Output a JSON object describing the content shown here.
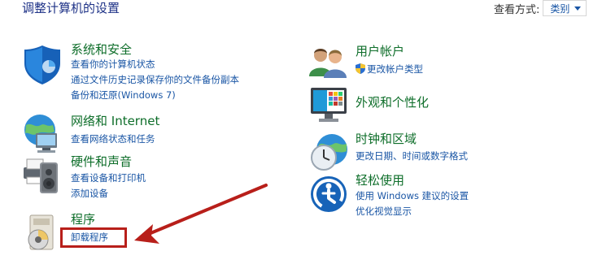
{
  "header": {
    "title": "调整计算机的设置",
    "view_by_label": "查看方式:",
    "view_by_value": "类别"
  },
  "categories": [
    {
      "title": "系统和安全",
      "icon": "shield-icon",
      "links": [
        "查看你的计算机状态",
        "通过文件历史记录保存你的文件备份副本",
        "备份和还原(Windows 7)"
      ]
    },
    {
      "title": "网络和 Internet",
      "icon": "network-globe-icon",
      "links": [
        "查看网络状态和任务"
      ]
    },
    {
      "title": "硬件和声音",
      "icon": "printer-speaker-icon",
      "links": [
        "查看设备和打印机",
        "添加设备"
      ]
    },
    {
      "title": "程序",
      "icon": "programs-disc-icon",
      "links": [
        "卸载程序"
      ]
    },
    {
      "title": "用户帐户",
      "icon": "users-icon",
      "links": [
        "更改帐户类型"
      ]
    },
    {
      "title": "外观和个性化",
      "icon": "monitor-palette-icon",
      "links": []
    },
    {
      "title": "时钟和区域",
      "icon": "clock-globe-icon",
      "links": [
        "更改日期、时间或数字格式"
      ]
    },
    {
      "title": "轻松使用",
      "icon": "ease-of-access-icon",
      "links": [
        "使用 Windows 建议的设置",
        "优化视觉显示"
      ]
    }
  ],
  "annotation": {
    "highlight_color": "#b81f1a"
  }
}
